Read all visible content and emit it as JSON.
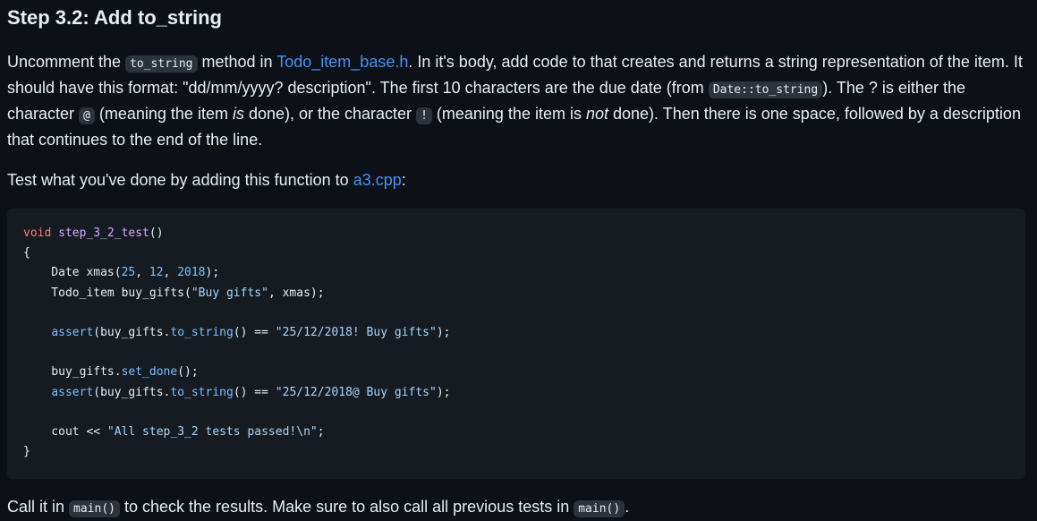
{
  "heading": "Step 3.2: Add to_string",
  "p1": {
    "t1": "Uncomment the ",
    "c1": "to_string",
    "t2": " method in ",
    "link1": "Todo_item_base.h",
    "t3": ". In it's body, add code to that creates and returns a string representation of the item. It should have this format: \"dd/mm/yyyy? description\". The first 10 characters are the due date (from ",
    "c2": "Date::to_string",
    "t4": "). The ? is either the character ",
    "c3": "@",
    "t5": " (meaning the item ",
    "em1": "is",
    "t6": " done), or the character ",
    "c4": "!",
    "t7": " (meaning the item is ",
    "em2": "not",
    "t8": " done). Then there is one space, followed by a description that continues to the end of the line."
  },
  "p2": {
    "t1": "Test what you've done by adding this function to ",
    "link": "a3.cpp",
    "t2": ":"
  },
  "code": {
    "l1_kw": "void",
    "l1_fn": "step_3_2_test",
    "l1_rest": "()",
    "l2": "{",
    "l3_a": "    Date xmas(",
    "l3_n1": "25",
    "l3_b": ", ",
    "l3_n2": "12",
    "l3_c": ", ",
    "l3_n3": "2018",
    "l3_d": ");",
    "l4_a": "    Todo_item buy_gifts(",
    "l4_s": "\"Buy gifts\"",
    "l4_b": ", xmas);",
    "l6_ind": "    ",
    "l6_fn": "assert",
    "l6_a": "(buy_gifts.",
    "l6_m": "to_string",
    "l6_b": "() == ",
    "l6_s": "\"25/12/2018! Buy gifts\"",
    "l6_c": ");",
    "l8_a": "    buy_gifts.",
    "l8_m": "set_done",
    "l8_b": "();",
    "l9_ind": "    ",
    "l9_fn": "assert",
    "l9_a": "(buy_gifts.",
    "l9_m": "to_string",
    "l9_b": "() == ",
    "l9_s": "\"25/12/2018@ Buy gifts\"",
    "l9_c": ");",
    "l11_a": "    cout << ",
    "l11_s": "\"All step_3_2 tests passed!\\n\"",
    "l11_b": ";",
    "l12": "}"
  },
  "p3": {
    "t1": "Call it in ",
    "c1": "main()",
    "t2": " to check the results. Make sure to also call all previous tests in ",
    "c2": "main()",
    "t3": "."
  }
}
